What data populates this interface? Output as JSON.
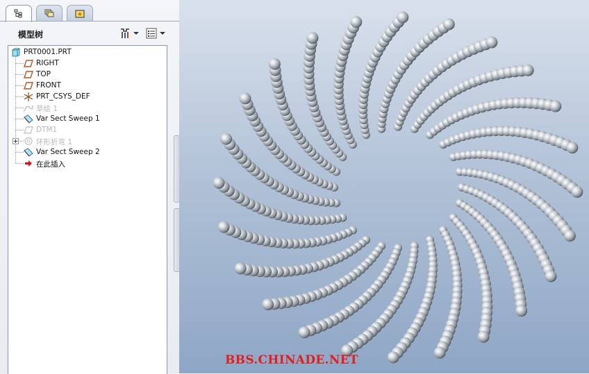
{
  "tabs": [
    {
      "name": "model-tree-tab",
      "icon": "tree-icon",
      "active": true
    },
    {
      "name": "layers-tab",
      "icon": "layers-icon",
      "active": false
    },
    {
      "name": "favorites-tab",
      "icon": "folder-star-icon",
      "active": false
    }
  ],
  "model_tree": {
    "title": "模型树",
    "settings_icon": "tools-icon",
    "show_icon": "list-icon",
    "items": [
      {
        "label": "PRT0001.PRT",
        "icon": "part-icon",
        "dim": false
      },
      {
        "label": "RIGHT",
        "icon": "datum-plane-icon",
        "dim": false
      },
      {
        "label": "TOP",
        "icon": "datum-plane-icon",
        "dim": false
      },
      {
        "label": "FRONT",
        "icon": "datum-plane-icon",
        "dim": false
      },
      {
        "label": "PRT_CSYS_DEF",
        "icon": "csys-icon",
        "dim": false
      },
      {
        "label": "草绘 1",
        "icon": "sketch-icon",
        "dim": true
      },
      {
        "label": "Var Sect Sweep 1",
        "icon": "sweep-icon",
        "dim": false
      },
      {
        "label": "DTM1",
        "icon": "datum-plane-icon",
        "dim": true
      },
      {
        "label": "环形折弯 1",
        "icon": "toroidal-bend-icon",
        "dim": true
      },
      {
        "label": "Var Sect Sweep 2",
        "icon": "sweep-icon",
        "dim": false
      },
      {
        "label": "在此插入",
        "icon": "insert-arrow-icon",
        "dim": false
      }
    ]
  },
  "viewport": {
    "model": "toroidal-spring-ring",
    "coil_count": 24,
    "watermark": "BBS.CHINADE.NET"
  },
  "colors": {
    "viewport_top": "#d9e1ec",
    "viewport_bottom": "#8ea6c5",
    "coil": "#c8cdd3",
    "watermark": "#e02020"
  }
}
